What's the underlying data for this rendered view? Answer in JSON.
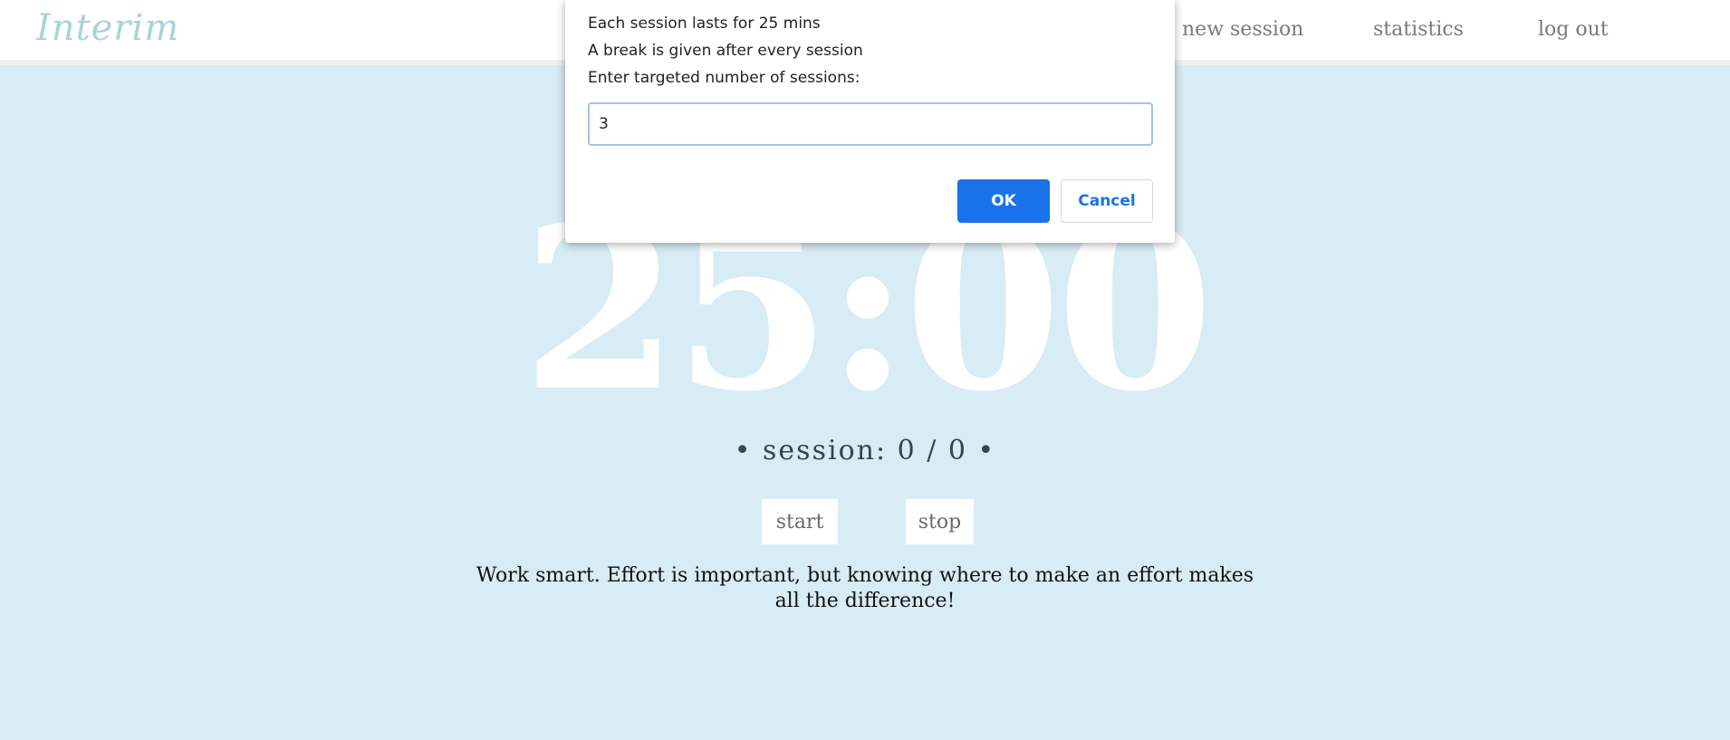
{
  "app": {
    "logo_text": "Interim"
  },
  "nav": {
    "new_session": "new session",
    "statistics": "statistics",
    "log_out": "log out"
  },
  "timer": {
    "display": "25:00"
  },
  "session": {
    "text": "• session: 0 / 0 •"
  },
  "controls": {
    "start_label": "start",
    "stop_label": "stop"
  },
  "quote": {
    "text": "Work smart. Effort is important, but knowing where to make an effort makes all the difference!"
  },
  "dialog": {
    "line1": "Each session lasts for 25 mins",
    "line2": "A break is given after every session",
    "line3": "Enter targeted number of sessions:",
    "input_value": "3",
    "ok_label": "OK",
    "cancel_label": "Cancel"
  },
  "colors": {
    "background": "#d8ecf5",
    "accent": "#1a73e8",
    "logo": "#a9d4d6"
  }
}
